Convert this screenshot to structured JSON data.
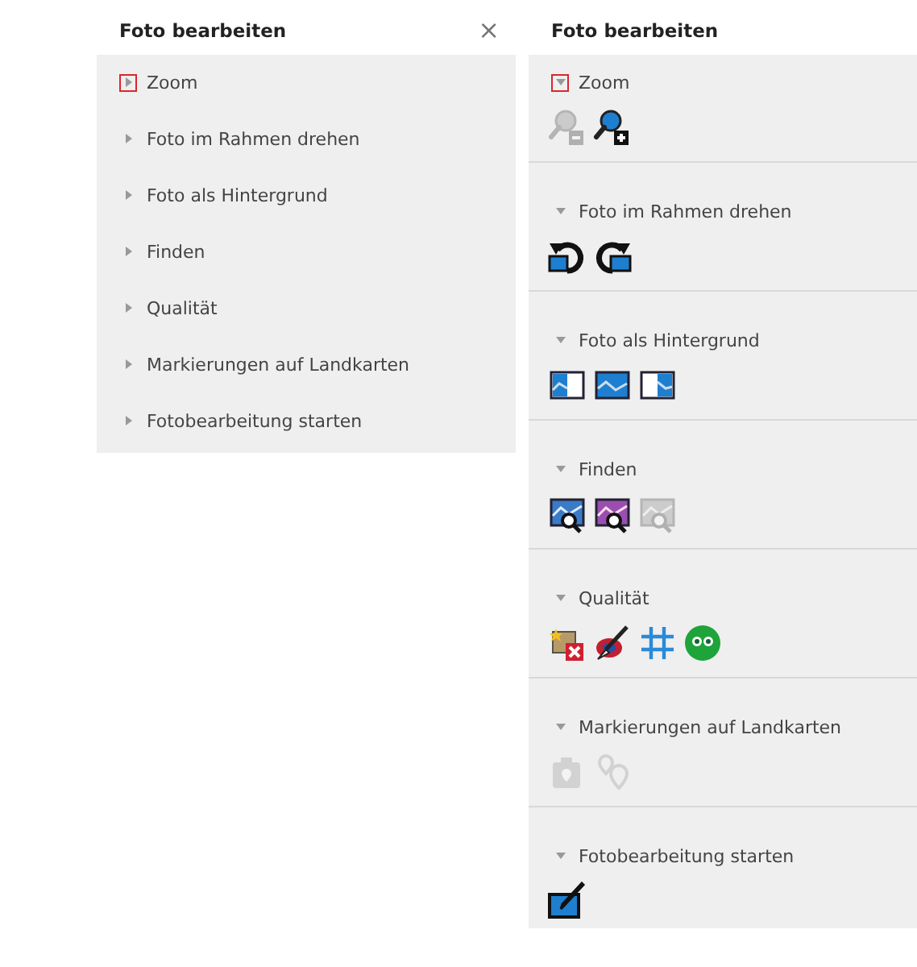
{
  "left_panel": {
    "title": "Foto bearbeiten",
    "close": "×",
    "sections": [
      {
        "label": "Zoom",
        "expanded": false,
        "highlighted": true
      },
      {
        "label": "Foto im Rahmen drehen",
        "expanded": false,
        "highlighted": false
      },
      {
        "label": "Foto als Hintergrund",
        "expanded": false,
        "highlighted": false
      },
      {
        "label": "Finden",
        "expanded": false,
        "highlighted": false
      },
      {
        "label": "Qualität",
        "expanded": false,
        "highlighted": false
      },
      {
        "label": "Markierungen auf Landkarten",
        "expanded": false,
        "highlighted": false
      },
      {
        "label": "Fotobearbeitung starten",
        "expanded": false,
        "highlighted": false
      }
    ]
  },
  "right_panel": {
    "title": "Foto bearbeiten",
    "sections": [
      {
        "label": "Zoom",
        "expanded": true,
        "highlighted": true,
        "tools": [
          {
            "kind": "zoom-out",
            "disabled": true
          },
          {
            "kind": "zoom-in",
            "disabled": false
          }
        ]
      },
      {
        "label": "Foto im Rahmen drehen",
        "expanded": true,
        "highlighted": false,
        "tools": [
          {
            "kind": "rotate-left",
            "disabled": false
          },
          {
            "kind": "rotate-right",
            "disabled": false
          }
        ]
      },
      {
        "label": "Foto als Hintergrund",
        "expanded": true,
        "highlighted": false,
        "tools": [
          {
            "kind": "bg-left",
            "disabled": false
          },
          {
            "kind": "bg-full",
            "disabled": false
          },
          {
            "kind": "bg-right",
            "disabled": false
          }
        ]
      },
      {
        "label": "Finden",
        "expanded": true,
        "highlighted": false,
        "tools": [
          {
            "kind": "find-blue",
            "disabled": false
          },
          {
            "kind": "find-purple",
            "disabled": false
          },
          {
            "kind": "find-blue",
            "disabled": true
          }
        ]
      },
      {
        "label": "Qualität",
        "expanded": true,
        "highlighted": false,
        "tools": [
          {
            "kind": "auto-fix",
            "disabled": false
          },
          {
            "kind": "brush",
            "disabled": false
          },
          {
            "kind": "grid",
            "disabled": false
          },
          {
            "kind": "green-eyes",
            "disabled": false
          }
        ]
      },
      {
        "label": "Markierungen auf Landkarten",
        "expanded": true,
        "highlighted": false,
        "tools": [
          {
            "kind": "map-pin",
            "disabled": true
          },
          {
            "kind": "map-pins",
            "disabled": true
          }
        ]
      },
      {
        "label": "Fotobearbeitung starten",
        "expanded": true,
        "highlighted": false,
        "tools": [
          {
            "kind": "edit",
            "disabled": false
          }
        ]
      }
    ]
  }
}
